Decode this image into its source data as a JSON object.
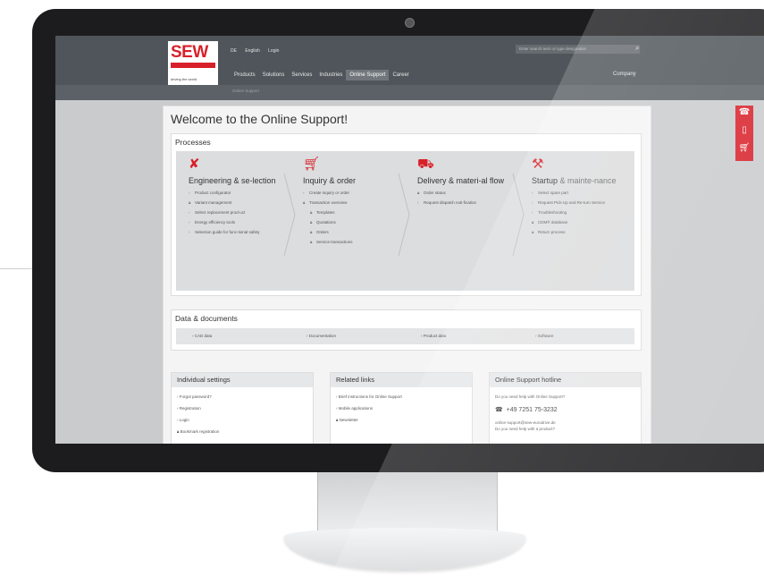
{
  "header": {
    "logo_text": "SEW",
    "logo_tagline": "driving the world",
    "utility": [
      "DE",
      "English",
      "Login"
    ],
    "nav": [
      "Products",
      "Solutions",
      "Services",
      "Industries",
      "Online Support",
      "Career"
    ],
    "company": "Company",
    "search_placeholder": "Enter search term or type designation",
    "subbar_label": "Online Support"
  },
  "page": {
    "title": "Welcome to the Online Support!",
    "processes_title": "Processes",
    "columns": [
      {
        "icon": "tools-icon",
        "title": "Engineering & se-lection",
        "items": [
          "Product configurator",
          "Variant management",
          "Select replacement prod-uct",
          "Energy efficiency tools",
          "Selection guide for func-tional safety"
        ]
      },
      {
        "icon": "cart-icon",
        "title": "Inquiry & order",
        "items": [
          "Create inquiry or order",
          "Transaction overview",
          "Templates",
          "Quotations",
          "Orders",
          "Service transactions"
        ]
      },
      {
        "icon": "truck-icon",
        "title": "Delivery & materi-al flow",
        "items": [
          "Order status",
          "Request dispatch noti-fication"
        ]
      },
      {
        "icon": "wrench-icon",
        "title_main": "Startup",
        "title_rest": " & mainte-nance",
        "items": [
          "Select spare part",
          "Request Pick-Up and Re-turn Service",
          "Troubleshooting",
          "CDM® database",
          "Return process"
        ]
      }
    ],
    "data_docs_title": "Data & documents",
    "data_docs": [
      "CAD data",
      "Documentation",
      "Product data",
      "Software"
    ],
    "individual_settings": {
      "title": "Individual settings",
      "items": [
        "Forgot password?",
        "Registration",
        "Login",
        "Bookmark registration"
      ]
    },
    "related_links": {
      "title": "Related links",
      "items": [
        "Brief instructions for Online Support",
        "Mobile applications",
        "Newsletter"
      ]
    },
    "hotline": {
      "title": "Online Support hotline",
      "question": "Do you need help with Online Support?",
      "phone": "+49 7251 75-3232",
      "email": "online-support@sew-eurodrive.de",
      "question2": "Do you need help with a product?"
    }
  }
}
